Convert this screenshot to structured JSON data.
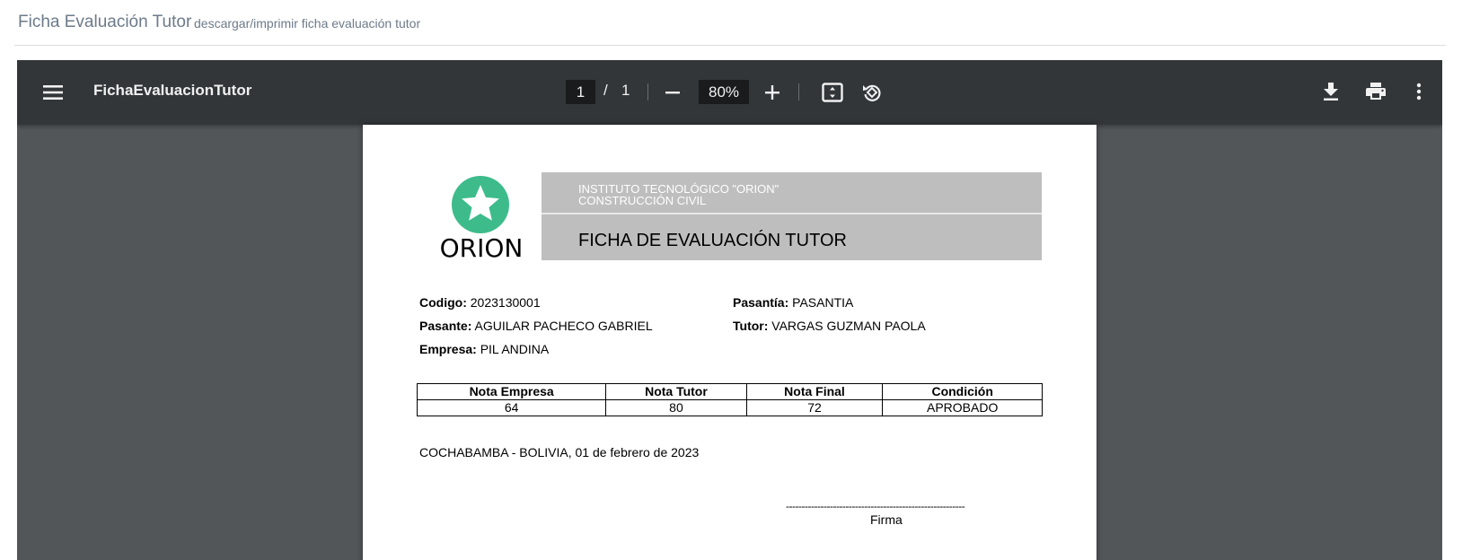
{
  "page": {
    "title": "Ficha Evaluación Tutor",
    "subtitle": "descargar/imprimir ficha evaluación tutor"
  },
  "viewer": {
    "document_name": "FichaEvaluacionTutor",
    "current_page": "1",
    "page_separator": "/",
    "total_pages": "1",
    "zoom": "80%",
    "icons": [
      "menu-icon",
      "zoom-out-icon",
      "zoom-in-icon",
      "fit-page-icon",
      "rotate-icon",
      "download-icon",
      "print-icon",
      "more-options-icon"
    ]
  },
  "document": {
    "logo_text": "ORION",
    "logo_color": "#3dbb8b",
    "institute": "INSTITUTO TECNOLÓGICO  \"ORION\"",
    "career": "CONSTRUCCIÓN CIVIL",
    "form_title": "FICHA DE EVALUACIÓN TUTOR",
    "fields": {
      "codigo_label": "Codigo:",
      "codigo_value": "2023130001",
      "pasante_label": "Pasante:",
      "pasante_value": "AGUILAR PACHECO GABRIEL",
      "empresa_label": "Empresa:",
      "empresa_value": "PIL ANDINA",
      "pasantia_label": "Pasantía:",
      "pasantia_value": "PASANTIA",
      "tutor_label": "Tutor:",
      "tutor_value": "VARGAS  GUZMAN PAOLA"
    },
    "grades_table": {
      "headers": [
        "Nota Empresa",
        "Nota Tutor",
        "Nota Final",
        "Condición"
      ],
      "row": [
        "64",
        "80",
        "72",
        "APROBADO"
      ]
    },
    "city_date": "COCHABAMBA - BOLIVIA, 01 de febrero de 2023",
    "signature_line": "---------------------------------------------------------",
    "signature_label": "Firma"
  }
}
